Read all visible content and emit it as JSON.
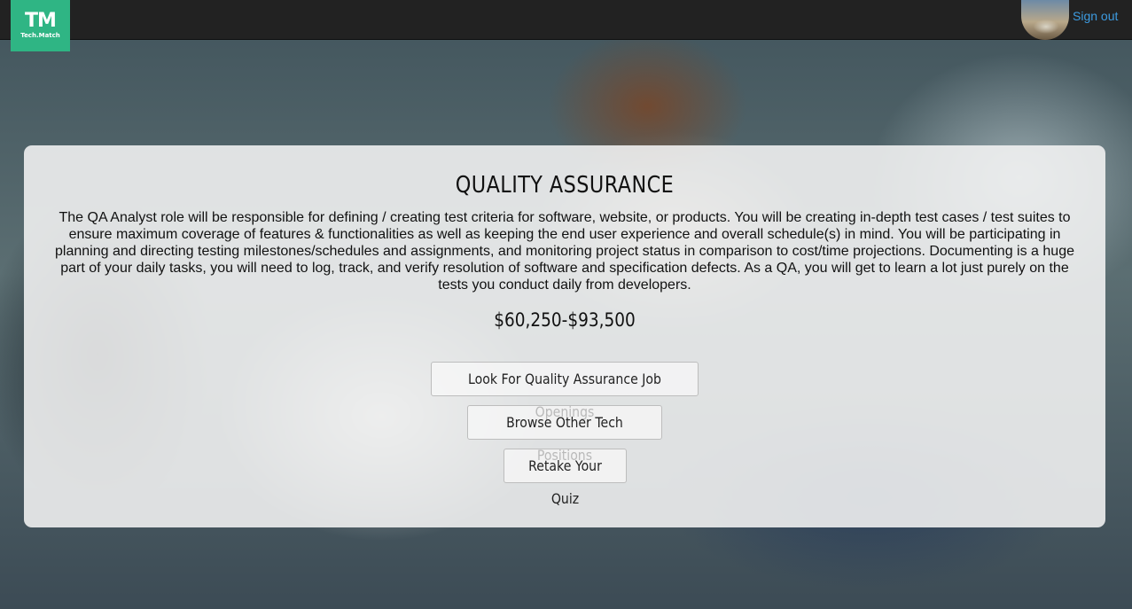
{
  "nav": {
    "logo_mark": "TM",
    "logo_text": "Tech.Match",
    "signout_label": "Sign out"
  },
  "card": {
    "title": "QUALITY ASSURANCE",
    "description": "The QA Analyst role will be responsible for defining / creating test criteria for software, website, or products. You will be creating in-depth test cases / test suites to ensure maximum coverage of features & functionalities as well as keeping the end user experience and overall schedule(s) in mind. You will be participating in planning and directing testing milestones/schedules and assignments, and monitoring project status in comparison to cost/time projections. Documenting is a huge part of your daily tasks, you will need to log, track, and verify resolution of software and specification defects. As a QA, you will get to learn a lot just purely on the tests you conduct daily from developers.",
    "salary": "$60,250-$93,500",
    "buttons": {
      "job_openings": "Look For Quality Assurance Job Openings",
      "browse_positions": "Browse Other Tech Positions",
      "retake_quiz": "Retake Your Quiz"
    }
  },
  "colors": {
    "navbar": "#222222",
    "logo_bg": "#2fb584",
    "link": "#3d9be0"
  }
}
